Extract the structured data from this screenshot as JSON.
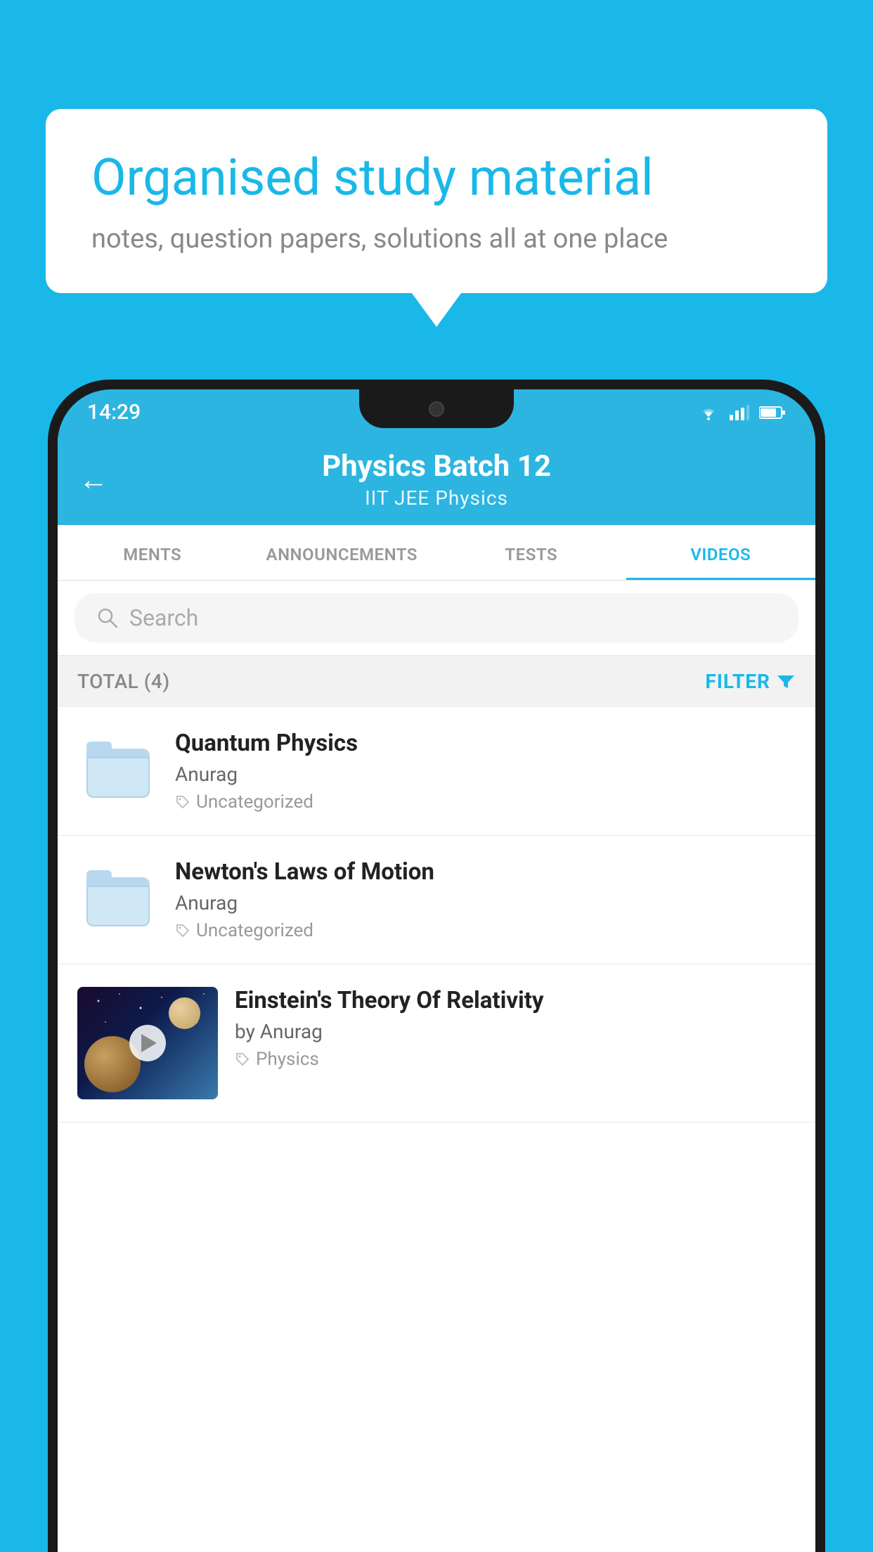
{
  "background_color": "#1ab8e8",
  "bubble": {
    "title": "Organised study material",
    "subtitle": "notes, question papers, solutions all at one place"
  },
  "status_bar": {
    "time": "14:29"
  },
  "header": {
    "title": "Physics Batch 12",
    "subtitle": "IIT JEE   Physics",
    "back_label": "←"
  },
  "tabs": [
    {
      "label": "MENTS",
      "active": false
    },
    {
      "label": "ANNOUNCEMENTS",
      "active": false
    },
    {
      "label": "TESTS",
      "active": false
    },
    {
      "label": "VIDEOS",
      "active": true
    }
  ],
  "search": {
    "placeholder": "Search"
  },
  "filter_bar": {
    "total": "TOTAL (4)",
    "filter_label": "FILTER"
  },
  "videos": [
    {
      "title": "Quantum Physics",
      "author": "Anurag",
      "tag": "Uncategorized",
      "type": "folder"
    },
    {
      "title": "Newton's Laws of Motion",
      "author": "Anurag",
      "tag": "Uncategorized",
      "type": "folder"
    },
    {
      "title": "Einstein's Theory Of Relativity",
      "author": "by Anurag",
      "tag": "Physics",
      "type": "video"
    }
  ]
}
